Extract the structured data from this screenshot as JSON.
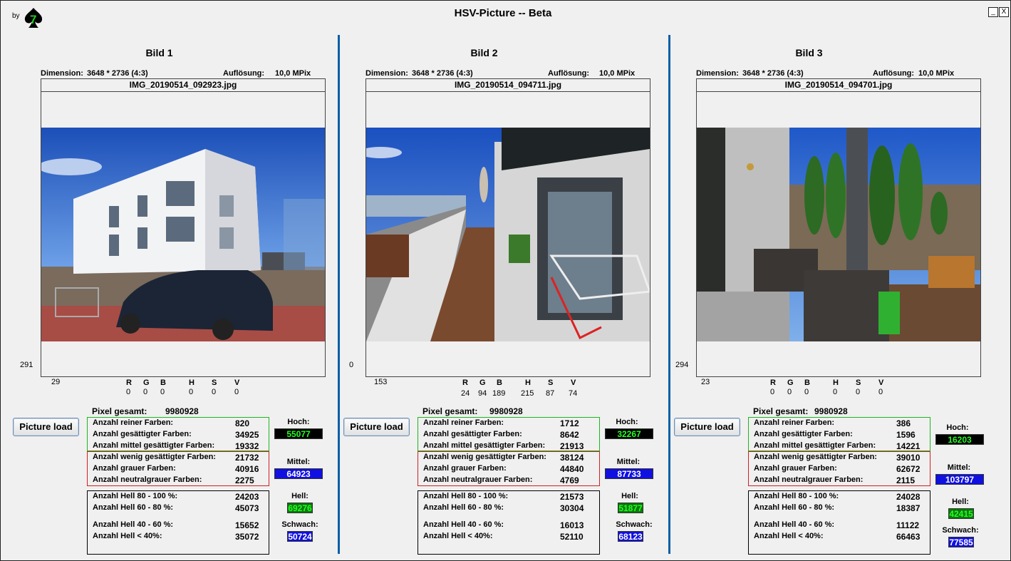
{
  "header": {
    "by_label": "by",
    "logo_text": "7",
    "title": "HSV-Picture -- Beta",
    "minimize_glyph": "_",
    "close_glyph": "X"
  },
  "labels": {
    "dimension": "Dimension:",
    "resolution": "Auflösung:",
    "button": "Picture load",
    "pixel_total": "Pixel gesamt:",
    "rgb_r": "R",
    "rgb_g": "G",
    "rgb_b": "B",
    "hsv_h": "H",
    "hsv_s": "S",
    "hsv_v": "V",
    "rein": "Anzahl reiner Farben:",
    "gesaettigt": "Anzahl gesättigter Farben:",
    "mittel_gesaettigt": "Anzahl mittel gesättigter Farben:",
    "wenig_gesaettigt": "Anzahl wenig gesättigter Farben:",
    "grau": "Anzahl grauer Farben:",
    "neutralgrau": "Anzahl neutralgrauer Farben:",
    "hell_80": "Anzahl Hell 80 - 100 %:",
    "hell_60": "Anzahl Hell 60 - 80 %:",
    "hell_40": "Anzahl Hell 40 - 60 %:",
    "hell_lt40": "Anzahl Hell < 40%:",
    "hoch": "Hoch:",
    "mittel": "Mittel:",
    "hell": "Hell:",
    "schwach": "Schwach:"
  },
  "panels": [
    {
      "title": "Bild 1",
      "dimension": "3648 * 2736 (4:3)",
      "resolution": "10,0 MPix",
      "filename": "IMG_20190514_092923.jpg",
      "cursor_y": "291",
      "cursor_x": "29",
      "rgb": [
        "0",
        "0",
        "0"
      ],
      "hsv": [
        "0",
        "0",
        "0"
      ],
      "pixel_total": "9980928",
      "rein": "820",
      "gesaettigt": "34925",
      "mittel_gesaettigt": "19332",
      "wenig_gesaettigt": "21732",
      "grau": "40916",
      "neutralgrau": "2275",
      "hell_80": "24203",
      "hell_60": "45073",
      "hell_40": "15652",
      "hell_lt40": "35072",
      "hoch": "55077",
      "mittel": "64923",
      "hell": "69276",
      "schwach": "50724"
    },
    {
      "title": "Bild 2",
      "dimension": "3648 * 2736 (4:3)",
      "resolution": "10,0 MPix",
      "filename": "IMG_20190514_094711.jpg",
      "cursor_y": "0",
      "cursor_x": "153",
      "rgb": [
        "24",
        "94",
        "189"
      ],
      "hsv": [
        "215",
        "87",
        "74"
      ],
      "pixel_total": "9980928",
      "rein": "1712",
      "gesaettigt": "8642",
      "mittel_gesaettigt": "21913",
      "wenig_gesaettigt": "38124",
      "grau": "44840",
      "neutralgrau": "4769",
      "hell_80": "21573",
      "hell_60": "30304",
      "hell_40": "16013",
      "hell_lt40": "52110",
      "hoch": "32267",
      "mittel": "87733",
      "hell": "51877",
      "schwach": "68123"
    },
    {
      "title": "Bild 3",
      "dimension": "3648 * 2736 (4:3)",
      "resolution": "10,0 MPix",
      "filename": "IMG_20190514_094701.jpg",
      "cursor_y": "294",
      "cursor_x": "23",
      "rgb": [
        "0",
        "0",
        "0"
      ],
      "hsv": [
        "0",
        "0",
        "0"
      ],
      "pixel_total": "9980928",
      "rein": "386",
      "gesaettigt": "1596",
      "mittel_gesaettigt": "14221",
      "wenig_gesaettigt": "39010",
      "grau": "62672",
      "neutralgrau": "2115",
      "hell_80": "24028",
      "hell_60": "18387",
      "hell_40": "11122",
      "hell_lt40": "66463",
      "hoch": "16203",
      "mittel": "103797",
      "hell": "42415",
      "schwach": "77585"
    }
  ],
  "colors": {
    "divider": "#0a5fa8",
    "box_green": "#1fb51f",
    "box_red": "#d02020",
    "chip_blue": "#1010e0",
    "chip_green_text": "#24ff24"
  }
}
